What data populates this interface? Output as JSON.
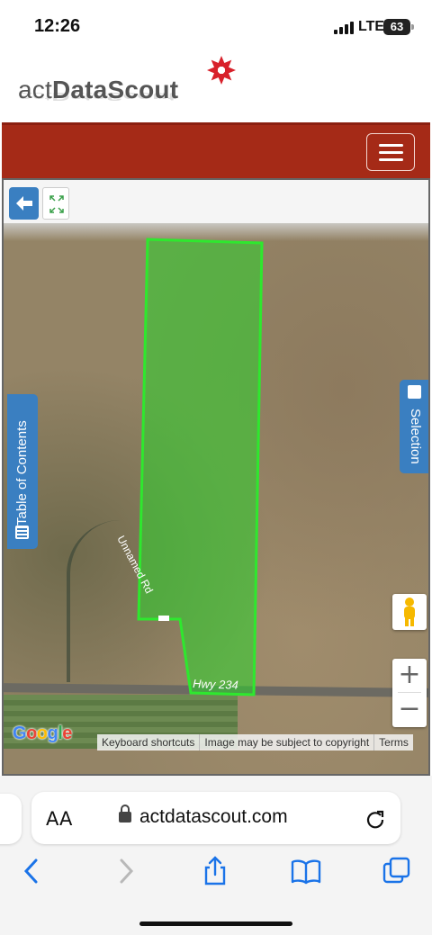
{
  "status_bar": {
    "time": "12:26",
    "network": "LTE",
    "battery": "63"
  },
  "site": {
    "logo_light": "act",
    "logo_bold": "DataScout"
  },
  "map": {
    "table_of_contents_label": "Table of Contents",
    "selection_label": "Selection",
    "road_label": "Hwy 234",
    "road_label_2": "Unnamed Rd",
    "zoom_in": "+",
    "zoom_out": "−",
    "google_logo": [
      "G",
      "o",
      "o",
      "g",
      "l",
      "e"
    ],
    "attribution": [
      "Keyboard shortcuts",
      "Image may be subject to copyright",
      "Terms"
    ]
  },
  "browser": {
    "text_size_label": "AA",
    "url": "actdatascout.com"
  },
  "colors": {
    "header_red": "#a52a17",
    "accent_blue": "#3a7fc1",
    "parcel_green": "#2bd42b"
  },
  "icons": [
    "signal-icon",
    "battery-icon",
    "menu-icon",
    "back-arrow-icon",
    "fullscreen-icon",
    "list-icon",
    "pegman-icon",
    "lock-icon",
    "reload-icon",
    "back-icon",
    "forward-icon",
    "share-icon",
    "bookmarks-icon",
    "tabs-icon"
  ]
}
